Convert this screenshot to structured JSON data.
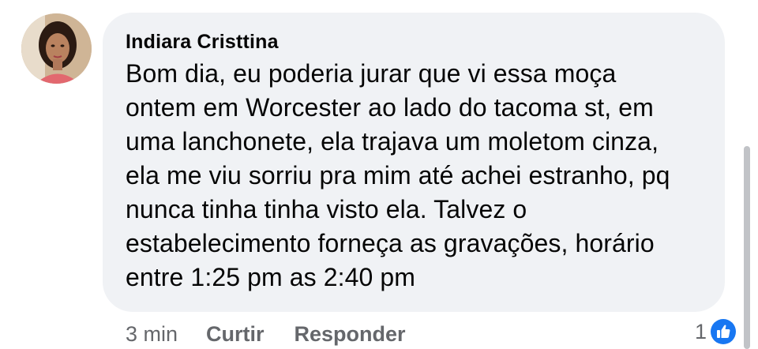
{
  "comment": {
    "author": "Indiara Cristtina",
    "text_lines": [
      "Bom dia, eu poderia jurar que vi essa moça",
      "ontem em Worcester ao lado do tacoma st, em",
      "uma lanchonete, ela trajava um moletom cinza,",
      "ela me viu sorriu pra mim até achei estranho, pq",
      "nunca tinha tinha visto ela. Talvez o",
      "estabelecimento forneça as gravações, horário",
      "entre 1:25 pm as 2:40 pm"
    ],
    "timestamp": "3 min",
    "like_label": "Curtir",
    "reply_label": "Responder",
    "reaction_count": "1",
    "reaction_icon": "thumbs-up-icon"
  },
  "colors": {
    "bubble_bg": "#f0f2f5",
    "meta_text": "#65676b",
    "like_blue": "#1877f2"
  }
}
